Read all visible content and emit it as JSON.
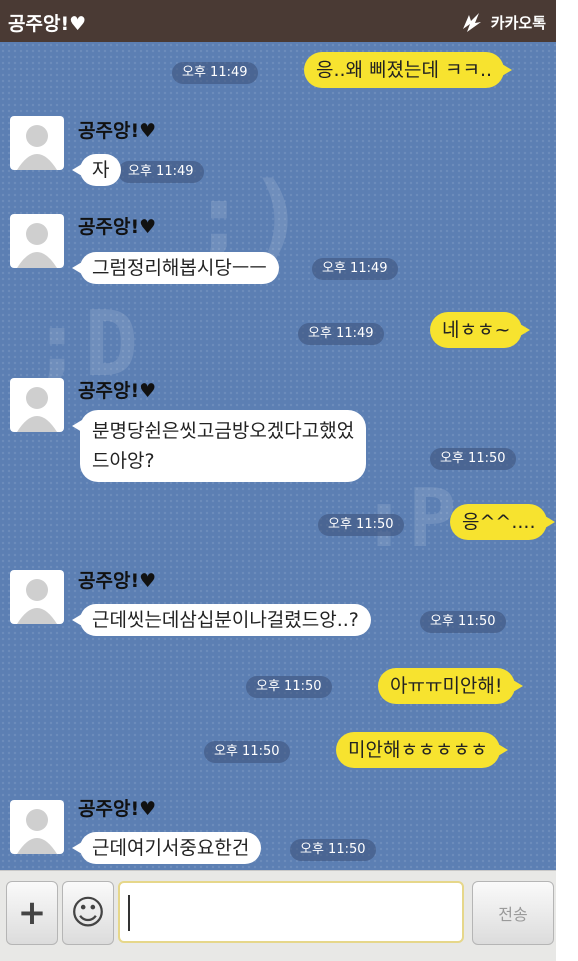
{
  "header": {
    "title": "공주앙!♥",
    "brand": "카카오톡"
  },
  "messages": [
    {
      "dir": "out",
      "text": "응..왜 삐졌는데 ㅋㅋ..",
      "time": "오후 11:49"
    },
    {
      "dir": "in",
      "sender": "공주앙!♥",
      "text": "자",
      "time": "오후 11:49"
    },
    {
      "dir": "in",
      "sender": "공주앙!♥",
      "text": "그럼정리해봅시당ㅡㅡ",
      "time": "오후 11:49"
    },
    {
      "dir": "out",
      "text": "네ㅎㅎ~",
      "time": "오후 11:49"
    },
    {
      "dir": "in",
      "sender": "공주앙!♥",
      "text_line1": "분명당쉰은씻고금방오겠다고했었",
      "text_line2": "드아앙?",
      "time": "오후 11:50"
    },
    {
      "dir": "out",
      "text": "응^^....",
      "time": "오후 11:50"
    },
    {
      "dir": "in",
      "sender": "공주앙!♥",
      "text": "근데씻는데삼십분이나걸렸드앙..?",
      "time": "오후 11:50"
    },
    {
      "dir": "out",
      "text": "아ㅠㅠ미안해!",
      "time": "오후 11:50"
    },
    {
      "dir": "out",
      "text": "미안해ㅎㅎㅎㅎㅎ",
      "time": "오후 11:50"
    },
    {
      "dir": "in",
      "sender": "공주앙!♥",
      "text": "근데여기서중요한건",
      "time": "오후 11:50"
    }
  ],
  "composer": {
    "plus": "+",
    "emoji": "☺",
    "send": "전송",
    "input_value": ""
  },
  "icons": {
    "avatar": "default-profile-icon",
    "brand": "kakaotalk-logo-icon",
    "plus": "plus-icon",
    "emoji": "emoticon-icon"
  }
}
